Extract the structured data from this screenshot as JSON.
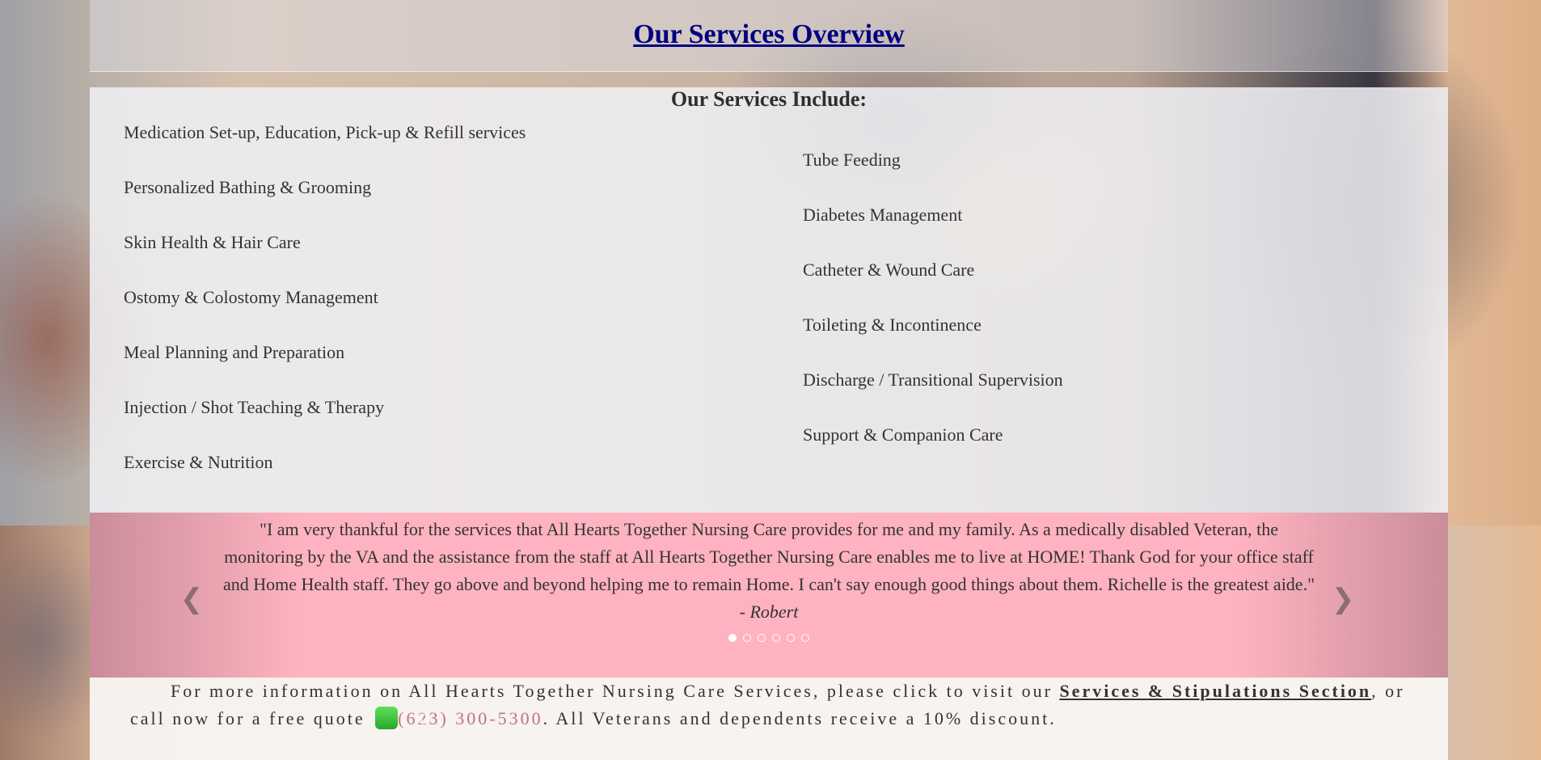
{
  "header": {
    "title": "Our Services Overview"
  },
  "services": {
    "heading": "Our Services Include:",
    "left": [
      "Medication Set-up, Education, Pick-up & Refill services",
      "Personalized Bathing & Grooming",
      "Skin Health & Hair Care",
      "Ostomy & Colostomy Management",
      "Meal Planning and Preparation",
      "Injection / Shot Teaching & Therapy",
      "Exercise & Nutrition"
    ],
    "right": [
      "Tube Feeding",
      "Diabetes Management",
      "Catheter & Wound Care",
      "Toileting & Incontinence",
      "Discharge / Transitional Supervision",
      "Support & Companion Care"
    ]
  },
  "testimonial": {
    "quote": "\"I am very thankful for the services that All Hearts Together Nursing Care provides for me and my family. As a medically disabled Veteran, the monitoring by the VA and the assistance from the staff at All Hearts Together Nursing Care enables me to live at HOME! Thank God for your office staff and Home Health staff. They go above and beyond helping me to remain Home. I can't say enough good things about them. Richelle is the greatest aide.\" - ",
    "author": "Robert",
    "prev_icon": "chevron-left-icon",
    "next_icon": "chevron-right-icon",
    "slide_count": 6,
    "active_slide": 1
  },
  "info": {
    "text_before": "For more information on All Hearts Together Nursing Care Services, please click to visit our ",
    "link_label": "Services & Stipulations Section",
    "text_middle": ", or call now for a free quote ",
    "phone_icon": "phone-icon",
    "phone": "(623) 300-5300",
    "text_after": ". All Veterans and dependents receive a 10% discount."
  },
  "colors": {
    "title": "#000080",
    "testimonial_bg": "#ffb3c0",
    "phone": "#c07088"
  }
}
